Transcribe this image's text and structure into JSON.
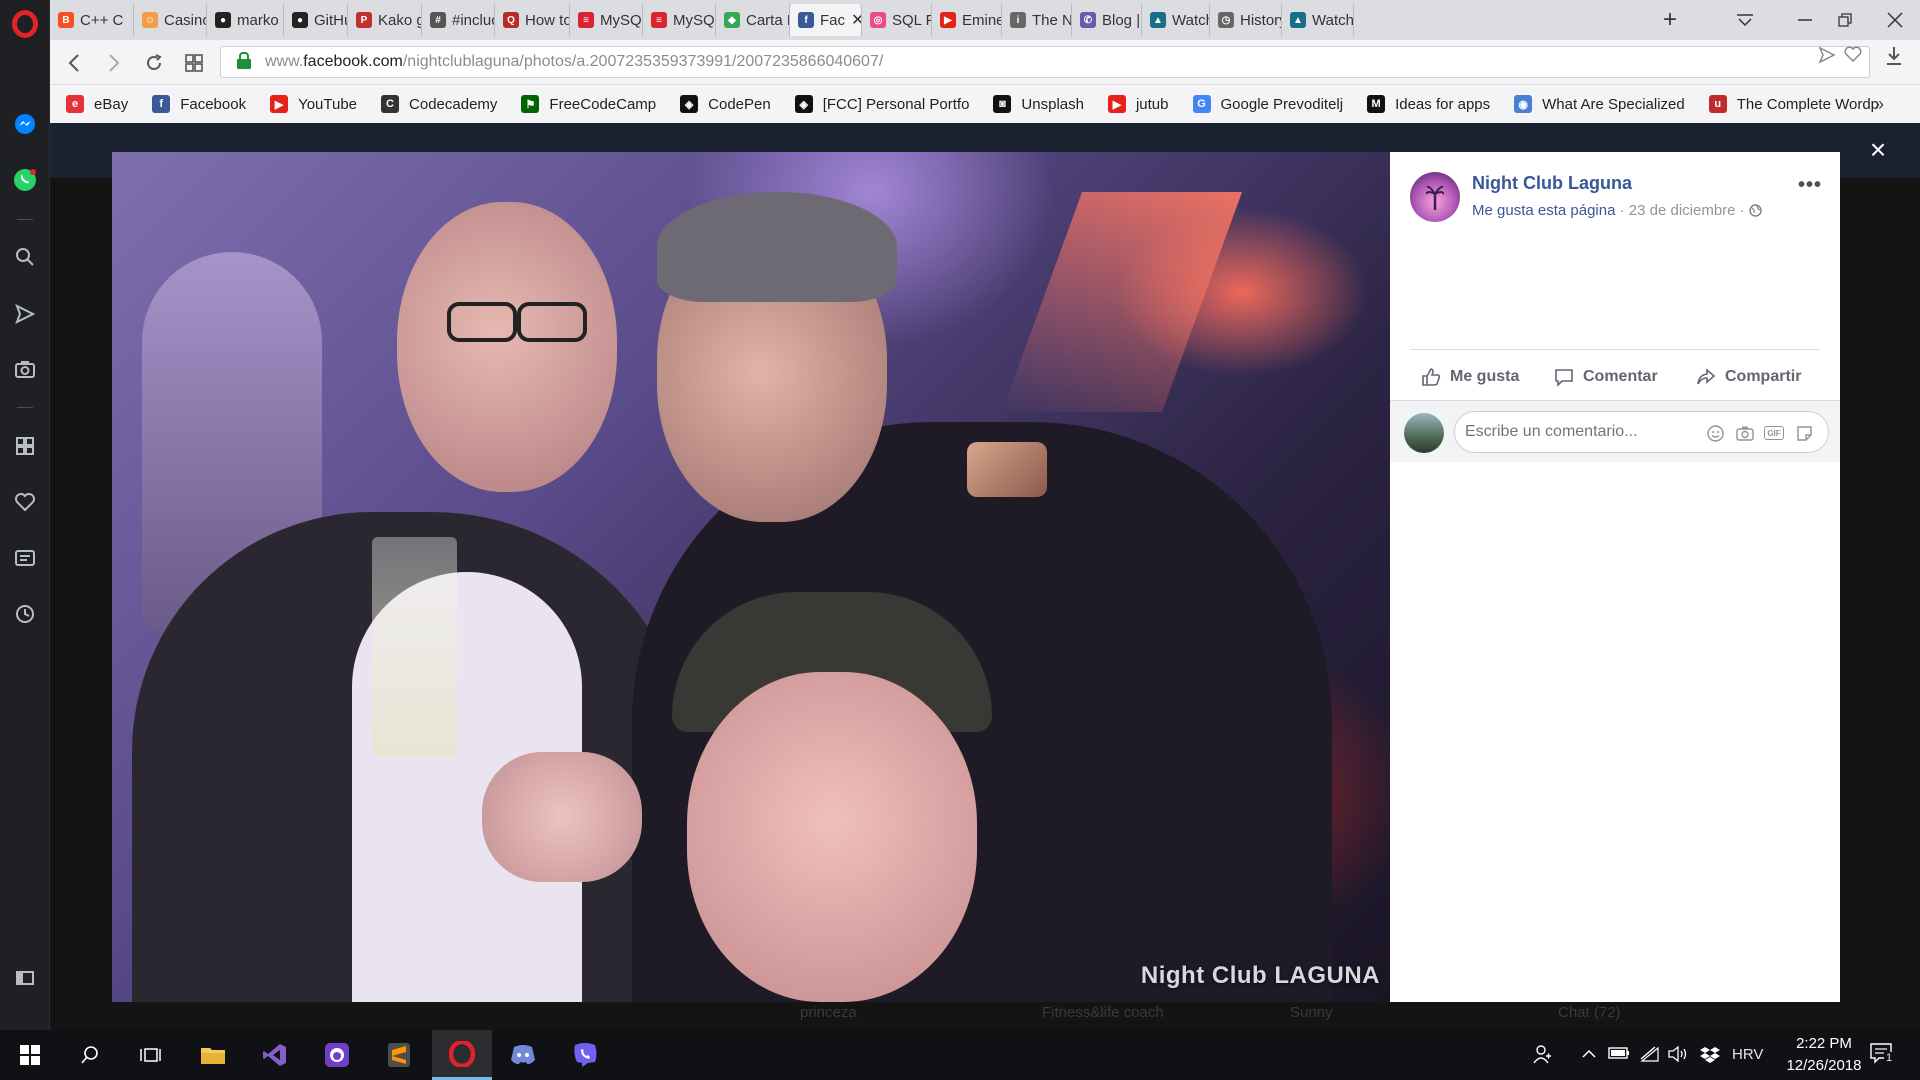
{
  "tabs": [
    {
      "label": "C++ C",
      "favicon_color": "#f4511e",
      "favicon_glyph": "B"
    },
    {
      "label": "Casino",
      "favicon_color": "#f39c4a",
      "favicon_glyph": "☺"
    },
    {
      "label": "marko",
      "favicon_color": "#222222",
      "favicon_glyph": "●"
    },
    {
      "label": "GitHub",
      "favicon_color": "#222222",
      "favicon_glyph": "●"
    },
    {
      "label": "Kako g",
      "favicon_color": "#c0312b",
      "favicon_glyph": "P"
    },
    {
      "label": "#incluc",
      "favicon_color": "#555555",
      "favicon_glyph": "#"
    },
    {
      "label": "How to",
      "favicon_color": "#b92b27",
      "favicon_glyph": "Q"
    },
    {
      "label": "MySQL",
      "favicon_color": "#d9232e",
      "favicon_glyph": "≡"
    },
    {
      "label": "MySQL",
      "favicon_color": "#d9232e",
      "favicon_glyph": "≡"
    },
    {
      "label": "Carta N",
      "favicon_color": "#34a853",
      "favicon_glyph": "◆"
    },
    {
      "label": "Fac",
      "favicon_color": "#3b5998",
      "favicon_glyph": "f",
      "active": true
    },
    {
      "label": "SQL Fu",
      "favicon_color": "#e94b8a",
      "favicon_glyph": "◎"
    },
    {
      "label": "Eminer",
      "favicon_color": "#e62117",
      "favicon_glyph": "▶"
    },
    {
      "label": "The Nc",
      "favicon_color": "#666666",
      "favicon_glyph": "i"
    },
    {
      "label": "Blog | V",
      "favicon_color": "#665cac",
      "favicon_glyph": "✆"
    },
    {
      "label": "Watch",
      "favicon_color": "#1a6e8a",
      "favicon_glyph": "▲"
    },
    {
      "label": "History",
      "favicon_color": "#666666",
      "favicon_glyph": "◷"
    },
    {
      "label": "Watch",
      "favicon_color": "#1a6e8a",
      "favicon_glyph": "▲"
    }
  ],
  "address": {
    "url_prefix": "www.",
    "url_domain": "facebook.com",
    "url_path": "/nightclublaguna/photos/a.2007235359373991/2007235866040607/"
  },
  "bookmarks": [
    {
      "label": "eBay",
      "icon_color": "#e53238",
      "glyph": "e"
    },
    {
      "label": "Facebook",
      "icon_color": "#3b5998",
      "glyph": "f"
    },
    {
      "label": "YouTube",
      "icon_color": "#e62117",
      "glyph": "▶"
    },
    {
      "label": "Codecademy",
      "icon_color": "#333333",
      "glyph": "C"
    },
    {
      "label": "FreeCodeCamp",
      "icon_color": "#006400",
      "glyph": "⚑"
    },
    {
      "label": "CodePen",
      "icon_color": "#111111",
      "glyph": "◈"
    },
    {
      "label": "[FCC] Personal Portfo",
      "icon_color": "#111111",
      "glyph": "◈"
    },
    {
      "label": "Unsplash",
      "icon_color": "#111111",
      "glyph": "◙"
    },
    {
      "label": "jutub",
      "icon_color": "#e62117",
      "glyph": "▶"
    },
    {
      "label": "Google Prevoditelj",
      "icon_color": "#4285f4",
      "glyph": "G"
    },
    {
      "label": "Ideas for apps",
      "icon_color": "#111111",
      "glyph": "M"
    },
    {
      "label": "What Are Specialized",
      "icon_color": "#4a7fd6",
      "glyph": "◉"
    },
    {
      "label": "The Complete Wordp",
      "icon_color": "#c02a2a",
      "glyph": "u"
    }
  ],
  "photo": {
    "watermark": "Night Club LAGUNA"
  },
  "post": {
    "page_name": "Night Club Laguna",
    "like_page": "Me gusta esta página",
    "separator": " · ",
    "date": "23 de diciembre",
    "privacy_icon": "globe-icon",
    "more": "•••",
    "actions": {
      "like": "Me gusta",
      "comment": "Comentar",
      "share": "Compartir"
    },
    "comment_placeholder": "Escribe un comentario..."
  },
  "ghost": {
    "chat": "Chat (72)",
    "princess": "princeza",
    "fitness": "Fitness&life coach",
    "sunny": "Sunny"
  },
  "taskbar": {
    "language": "HRV",
    "time": "2:22 PM",
    "date": "12/26/2018",
    "notification_count": "1"
  },
  "colors": {
    "facebook_blue": "#385898",
    "opera_red": "#e0232b"
  }
}
